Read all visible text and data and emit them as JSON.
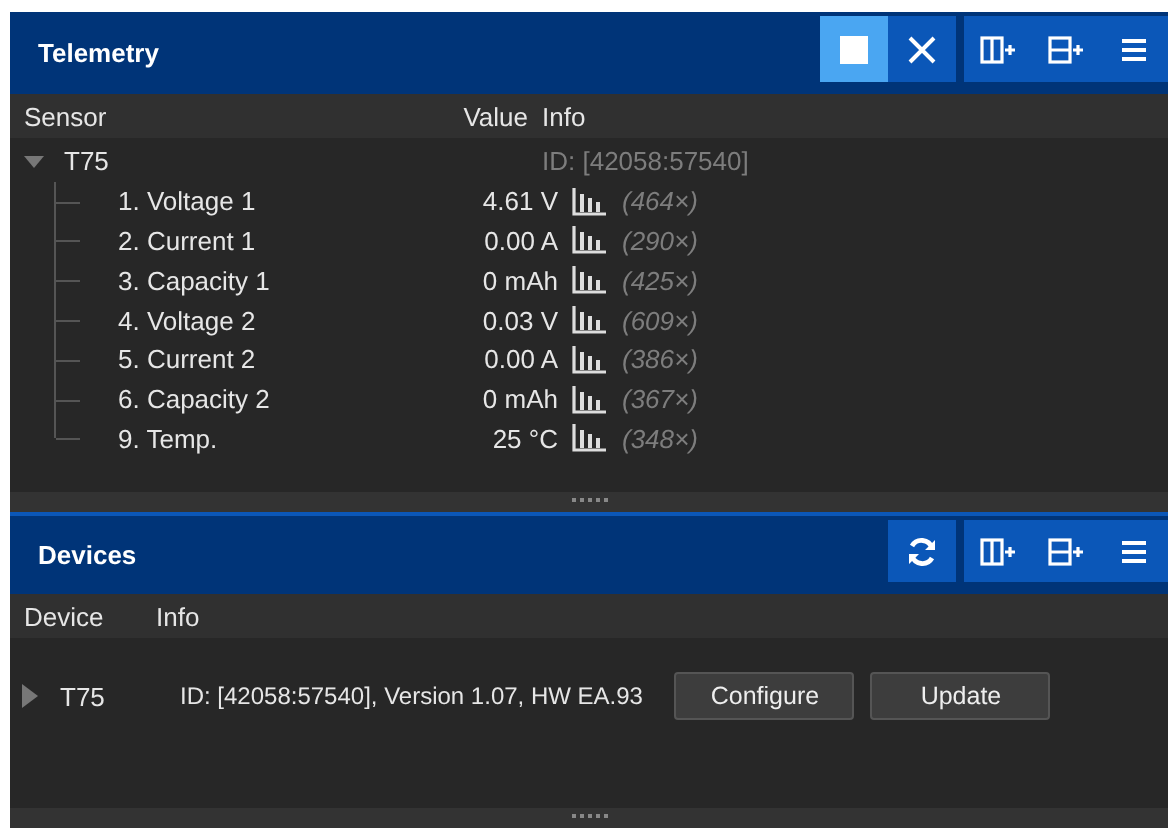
{
  "telemetry": {
    "title": "Telemetry",
    "tools": [
      {
        "kind": "stop",
        "on": true
      },
      {
        "kind": "close",
        "on": false
      }
    ],
    "layout_tools": [
      {
        "kind": "columns"
      },
      {
        "kind": "rows"
      },
      {
        "kind": "menu"
      }
    ],
    "columns": [
      "Sensor",
      "Value",
      "Info"
    ],
    "tree": [
      {
        "name": "T75",
        "info": "ID: [42058:57540]",
        "expanded": true,
        "children": [
          {
            "name": "1. Voltage 1",
            "value": "4.61 V",
            "count": "(464×)"
          },
          {
            "name": "2. Current 1",
            "value": "0.00 A",
            "count": "(290×)"
          },
          {
            "name": "3. Capacity 1",
            "value": "0 mAh",
            "count": "(425×)"
          },
          {
            "name": "4. Voltage 2",
            "value": "0.03 V",
            "count": "(609×)"
          },
          {
            "name": "5. Current 2",
            "value": "0.00 A",
            "count": "(386×)"
          },
          {
            "name": "6. Capacity 2",
            "value": "0 mAh",
            "count": "(367×)"
          },
          {
            "name": "9. Temp.",
            "value": "25 °C",
            "count": "(348×)"
          }
        ]
      }
    ]
  },
  "devices": {
    "title": "Devices",
    "tools": [
      {
        "kind": "refresh",
        "on": false
      }
    ],
    "layout_tools": [
      {
        "kind": "columns"
      },
      {
        "kind": "rows"
      },
      {
        "kind": "menu"
      }
    ],
    "columns": [
      "Device",
      "Info"
    ],
    "rows": [
      {
        "name": "T75",
        "info": "ID: [42058:57540], Version  1.07, HW EA.93",
        "expanded": false,
        "buttons": [
          "Configure",
          "Update"
        ]
      }
    ]
  }
}
